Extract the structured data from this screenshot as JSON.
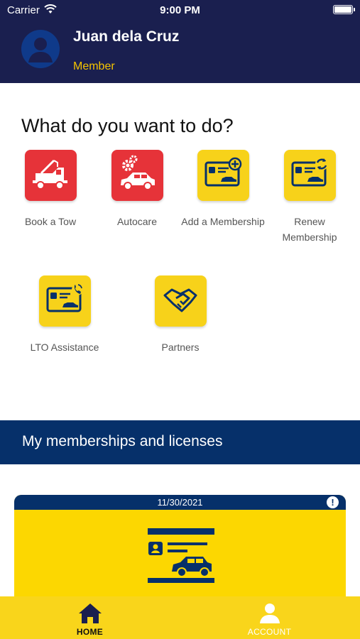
{
  "status_bar": {
    "carrier": "Carrier",
    "time": "9:00 PM"
  },
  "profile": {
    "name": "Juan dela Cruz",
    "role": "Member"
  },
  "actions_title": "What do you want to do?",
  "actions": [
    {
      "label": "Book a Tow",
      "icon": "tow-truck-icon",
      "color": "#e63339"
    },
    {
      "label": "Autocare",
      "icon": "car-gear-icon",
      "color": "#e63339"
    },
    {
      "label": "Add a Membership",
      "icon": "card-add-icon",
      "color": "#f7d21a"
    },
    {
      "label": "Renew Membership",
      "icon": "card-renew-icon",
      "color": "#f7d21a"
    },
    {
      "label": "LTO Assistance",
      "icon": "card-phone-icon",
      "color": "#f7d21a"
    },
    {
      "label": "Partners",
      "icon": "handshake-icon",
      "color": "#f7d21a"
    }
  ],
  "memberships": {
    "title": "My memberships and licenses",
    "card": {
      "date": "11/30/2021",
      "alert": "!"
    }
  },
  "nav": {
    "home": "HOME",
    "account": "ACCOUNT"
  },
  "colors": {
    "header": "#1a1f4f",
    "brand_blue": "#06306a",
    "brand_yellow": "#f7d21a",
    "accent_red": "#e63339"
  }
}
